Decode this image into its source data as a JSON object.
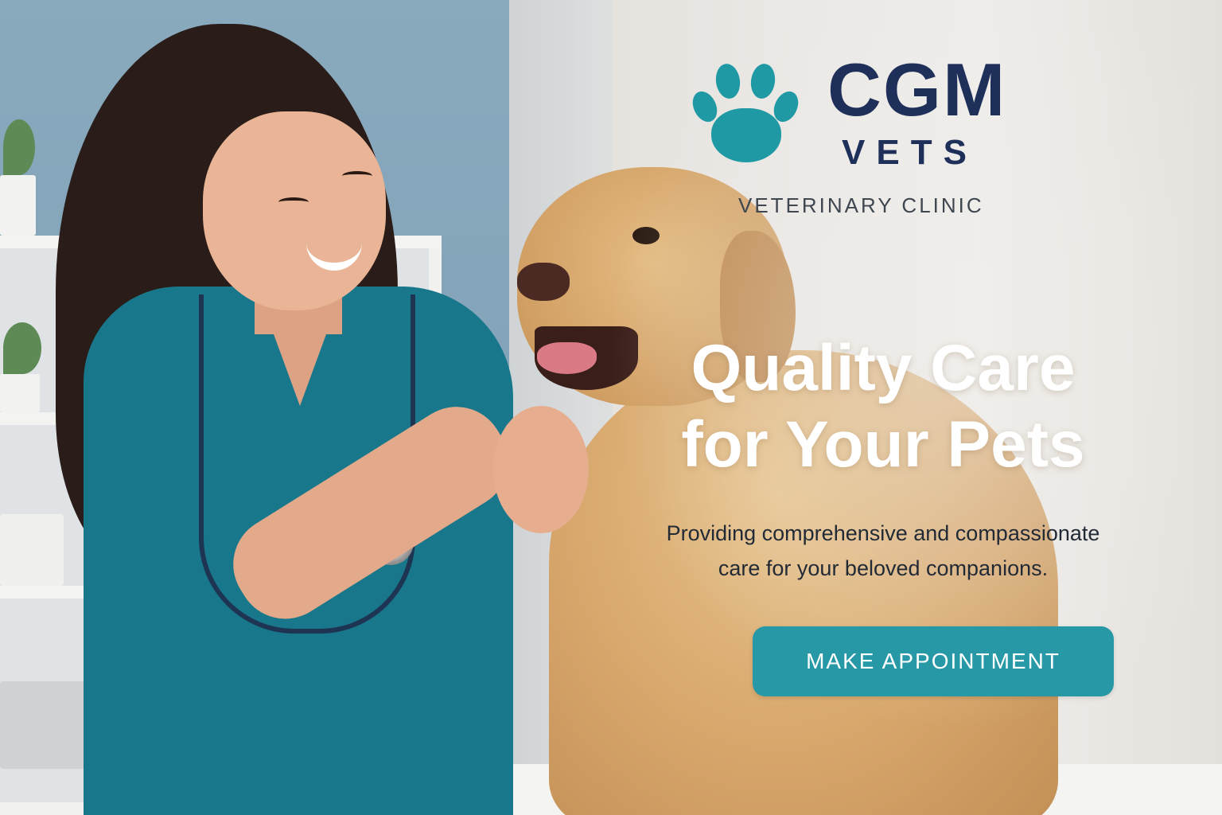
{
  "brand": {
    "name": "CGM",
    "sub": "VETS",
    "tagline": "VETERINARY CLINIC",
    "logo_icon": "paw-icon"
  },
  "hero": {
    "headline_line1": "Quality Care",
    "headline_line2": "for Your Pets",
    "subtext_line1": "Providing comprehensive and compassionate",
    "subtext_line2": "care for your beloved companions.",
    "cta_label": "MAKE APPOINTMENT"
  },
  "colors": {
    "brand_navy": "#1e2f5a",
    "accent_teal": "#2799a6",
    "paw_teal": "#1f9aa5",
    "headline": "#ffffff",
    "subtext": "#222a36"
  }
}
